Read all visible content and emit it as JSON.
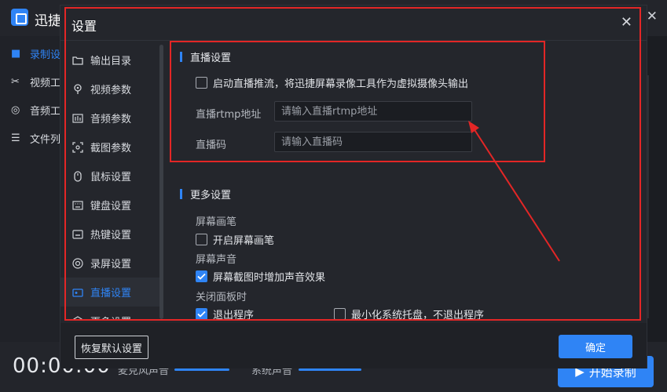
{
  "app": {
    "name": "迅捷",
    "sidebar": [
      {
        "label": "录制设",
        "icon": "video-camera-icon"
      },
      {
        "label": "视频工",
        "icon": "scissors-icon"
      },
      {
        "label": "音频工",
        "icon": "audio-icon"
      },
      {
        "label": "文件列",
        "icon": "list-icon"
      }
    ],
    "timer": "00:00:00",
    "mic_label": "麦克风声音",
    "system_label": "系统声音",
    "start_label": "开始录制"
  },
  "dialog": {
    "title": "设置",
    "nav": [
      {
        "label": "输出目录",
        "icon": "folder-icon"
      },
      {
        "label": "视频参数",
        "icon": "pin-icon"
      },
      {
        "label": "音频参数",
        "icon": "equalizer-icon"
      },
      {
        "label": "截图参数",
        "icon": "crop-icon"
      },
      {
        "label": "鼠标设置",
        "icon": "mouse-icon"
      },
      {
        "label": "键盘设置",
        "icon": "keyboard-icon"
      },
      {
        "label": "热键设置",
        "icon": "hotkey-icon"
      },
      {
        "label": "录屏设置",
        "icon": "record-icon"
      },
      {
        "label": "直播设置",
        "icon": "live-icon"
      },
      {
        "label": "更多设置",
        "icon": "more-gear-icon"
      }
    ],
    "live": {
      "heading": "直播设置",
      "enable_label": "启动直播推流，将迅捷屏幕录像工具作为虚拟摄像头输出",
      "enable_checked": false,
      "rtmp_label": "直播rtmp地址",
      "rtmp_placeholder": "请输入直播rtmp地址",
      "code_label": "直播码",
      "code_placeholder": "请输入直播码"
    },
    "more": {
      "heading": "更多设置",
      "pen_group": "屏幕画笔",
      "pen_label": "开启屏幕画笔",
      "pen_checked": false,
      "sound_group": "屏幕声音",
      "sound_label": "屏幕截图时增加声音效果",
      "sound_checked": true,
      "close_group": "关闭面板时",
      "exit_label": "退出程序",
      "exit_checked": true,
      "tray_label": "最小化系统托盘，不退出程序",
      "tray_checked": false
    },
    "reset_label": "恢复默认设置",
    "ok_label": "确定"
  },
  "colors": {
    "accent": "#2f84f5",
    "annotation": "#e32626"
  }
}
